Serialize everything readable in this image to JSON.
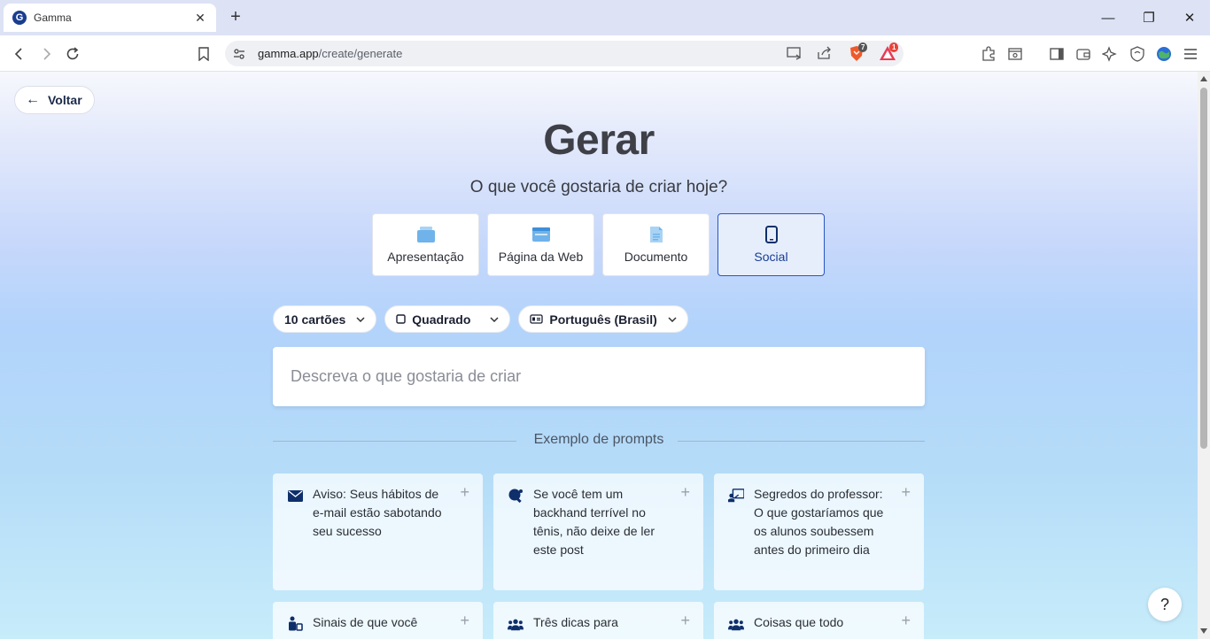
{
  "browser": {
    "tab_title": "Gamma",
    "favicon_letter": "G",
    "tab_close": "✕",
    "new_tab": "+",
    "url_host": "gamma.app",
    "url_path": "/create/generate",
    "brave_badge": "7",
    "rewards_badge": "1",
    "minimize": "—",
    "maximize": "❐",
    "close": "✕"
  },
  "page": {
    "back_label": "Voltar",
    "title": "Gerar",
    "subtitle": "O que você gostaria de criar hoje?",
    "types": [
      {
        "label": "Apresentação",
        "icon": "presentation-icon"
      },
      {
        "label": "Página da Web",
        "icon": "webpage-icon"
      },
      {
        "label": "Documento",
        "icon": "document-icon"
      },
      {
        "label": "Social",
        "icon": "phone-icon",
        "selected": true
      }
    ],
    "options": {
      "cards": "10 cartões",
      "format": "Quadrado",
      "language": "Português (Brasil)"
    },
    "prompt_placeholder": "Descreva o que gostaria de criar",
    "examples_label": "Exemplo de prompts",
    "examples": [
      {
        "icon": "envelope-icon",
        "text": "Aviso: Seus hábitos de e-mail estão sabotando seu sucesso"
      },
      {
        "icon": "table-tennis-icon",
        "text": "Se você tem um backhand terrível no tênis, não deixe de ler este post"
      },
      {
        "icon": "teacher-icon",
        "text": "Segredos do professor: O que gostaríamos que os alunos soubessem antes do primeiro dia"
      },
      {
        "icon": "person-bag-icon",
        "text": "Sinais de que você"
      },
      {
        "icon": "users-icon",
        "text": "Três dicas para"
      },
      {
        "icon": "users-icon",
        "text": "Coisas que todo"
      }
    ],
    "help": "?"
  },
  "colors": {
    "accent": "#2757c4",
    "heading": "#3f4047",
    "icon_navy": "#0f2f6b",
    "icon_light_blue": "#6fb3ea"
  }
}
